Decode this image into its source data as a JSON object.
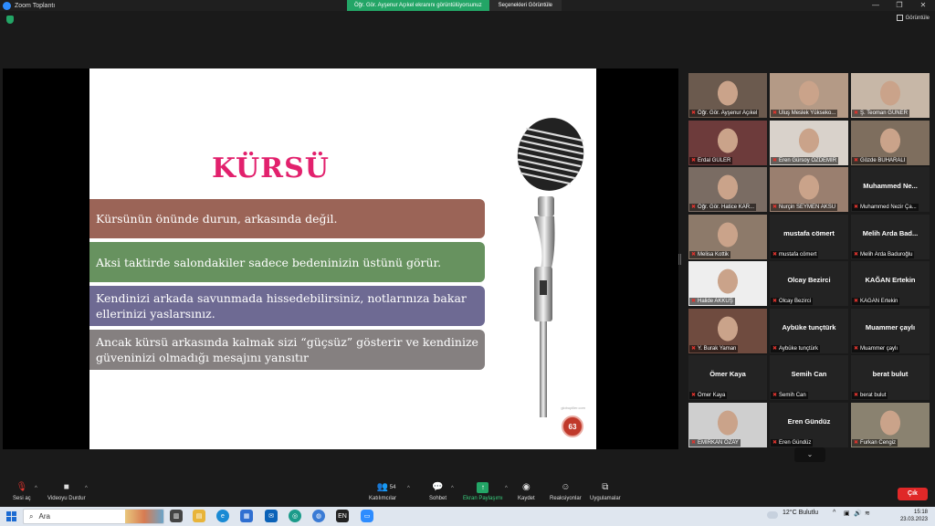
{
  "window": {
    "title": "Zoom Toplantı"
  },
  "share_banner": {
    "status": "Öğr. Gör. Ayşenur Açıkel ekranını görüntülüyorsunuz",
    "options": "Seçenekleri Görüntüle"
  },
  "window_controls": {
    "minimize": "—",
    "maximize": "❐",
    "close": "✕"
  },
  "view_button": {
    "label": "Görüntüle"
  },
  "slide": {
    "title": "KÜRSÜ",
    "bullets": [
      "Kürsünün önünde durun, arkasında değil.",
      "Aksi taktirde salondakiler sadece bedeninizin üstünü görür.",
      "Kendinizi arkada savunmada hissedebilirsiniz, notlarınıza bakar ellerinizi yaslarsınız.",
      "Ancak kürsü arkasında kalmak sizi “güçsüz” gösterir ve kendinize güveninizi olmadığı mesajını yansıtır"
    ],
    "watermark": "globupiller.com",
    "page_number": "63",
    "colors": {
      "title": "#e2216d",
      "bullet1": "#9b6457",
      "bullet2": "#67925f",
      "bullet3": "#6e6a93",
      "bullet4": "#858080"
    }
  },
  "participants": [
    {
      "label": "Öğr. Gör. Ayşenur Açıkel",
      "big": "",
      "video": true,
      "active": true
    },
    {
      "label": "Uluş Meslek Yüksekо...",
      "big": "",
      "video": true
    },
    {
      "label": "Ş. Teoman GÜNER",
      "big": "",
      "video": true
    },
    {
      "label": "Erdal GÜLER",
      "big": "",
      "video": true
    },
    {
      "label": "Eren Gürsoy ÖZDEMİR",
      "big": "",
      "video": true
    },
    {
      "label": "Gözde BUHARALI",
      "big": "",
      "video": true
    },
    {
      "label": "Öğr. Gör. Hatice KAR...",
      "big": "",
      "video": true
    },
    {
      "label": "Nurçin SEYMEN AKSU",
      "big": "",
      "video": true
    },
    {
      "label": "Muhammed Nezir Ça...",
      "big": "Muhammed Ne...",
      "video": false
    },
    {
      "label": "Melisa Kottik",
      "big": "",
      "video": true
    },
    {
      "label": "mustafa cömert",
      "big": "mustafa cömert",
      "video": false
    },
    {
      "label": "Melih Arda Baduroğlu",
      "big": "Melih Arda Bad...",
      "video": false
    },
    {
      "label": "Halide AKKUŞ",
      "big": "",
      "video": true
    },
    {
      "label": "Olcay Bezirci",
      "big": "Olcay Bezirci",
      "video": false
    },
    {
      "label": "KAĞAN Ertekin",
      "big": "KAĞAN Ertekin",
      "video": false
    },
    {
      "label": "Y. Burak Yaman",
      "big": "",
      "video": true
    },
    {
      "label": "Aybüke tunçtürk",
      "big": "Aybüke tunçtürk",
      "video": false
    },
    {
      "label": "Muammer çaylı",
      "big": "Muammer çaylı",
      "video": false
    },
    {
      "label": "Ömer Kaya",
      "big": "Ömer Kaya",
      "video": false
    },
    {
      "label": "Semih Can",
      "big": "Semih Can",
      "video": false
    },
    {
      "label": "berat bulut",
      "big": "berat bulut",
      "video": false
    },
    {
      "label": "EMİRKAN ÖZAY",
      "big": "",
      "video": true
    },
    {
      "label": "Eren Gündüz",
      "big": "Eren Gündüz",
      "video": false
    },
    {
      "label": "Furkan Cengiz",
      "big": "",
      "video": true
    }
  ],
  "toolbar": {
    "unmute": "Sesi aç",
    "stop_video": "Videoyu Durdur",
    "participants": "Katılımcılar",
    "participant_count": "54",
    "chat": "Sohbet",
    "share_screen": "Ekran Paylaşımı",
    "record": "Kaydet",
    "reactions": "Reaksiyonlar",
    "apps": "Uygulamalar",
    "leave": "Çık"
  },
  "taskbar": {
    "search_placeholder": "Ara",
    "weather": "12°C  Bulutlu",
    "time": "15:18",
    "date": "23.03.2023"
  }
}
